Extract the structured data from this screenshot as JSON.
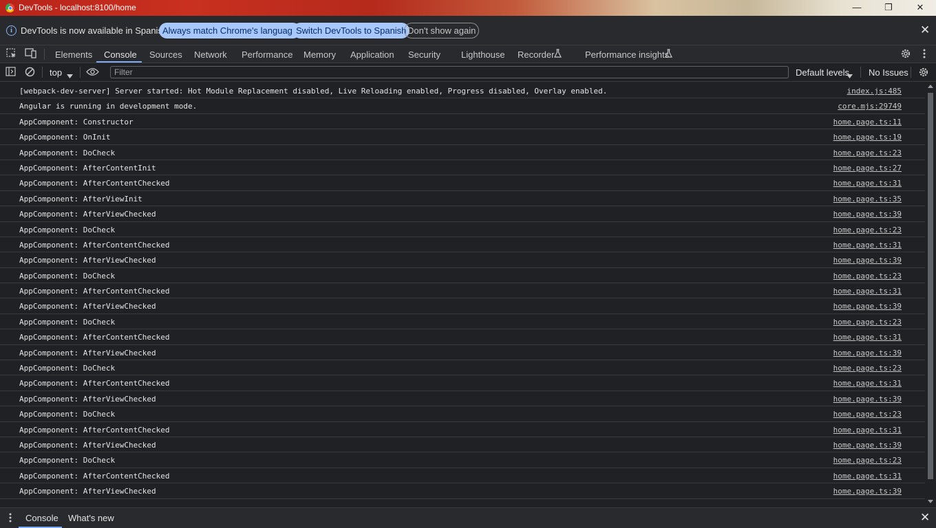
{
  "window": {
    "title": "DevTools - localhost:8100/home",
    "minimize": "—",
    "maximize": "❐",
    "close": "✕"
  },
  "infobar": {
    "message": "DevTools is now available in Spanish!",
    "btn_match": "Always match Chrome's language",
    "btn_switch": "Switch DevTools to Spanish",
    "btn_dismiss": "Don't show again",
    "close": "✕"
  },
  "tabs": [
    "Elements",
    "Console",
    "Sources",
    "Network",
    "Performance",
    "Memory",
    "Application",
    "Security",
    "Lighthouse",
    "Recorder",
    "Performance insights"
  ],
  "active_tab": "Console",
  "toolbar": {
    "context": "top",
    "filter_placeholder": "Filter",
    "levels": "Default levels",
    "issues": "No Issues"
  },
  "logs": [
    {
      "msg": "[webpack-dev-server] Server started: Hot Module Replacement disabled, Live Reloading enabled, Progress disabled, Overlay enabled.",
      "src": "index.js:485"
    },
    {
      "msg": "Angular is running in development mode.",
      "src": "core.mjs:29749"
    },
    {
      "msg": "AppComponent: Constructor",
      "src": "home.page.ts:11"
    },
    {
      "msg": "AppComponent: OnInit",
      "src": "home.page.ts:19"
    },
    {
      "msg": "AppComponent: DoCheck",
      "src": "home.page.ts:23"
    },
    {
      "msg": "AppComponent: AfterContentInit",
      "src": "home.page.ts:27"
    },
    {
      "msg": "AppComponent: AfterContentChecked",
      "src": "home.page.ts:31"
    },
    {
      "msg": "AppComponent: AfterViewInit",
      "src": "home.page.ts:35"
    },
    {
      "msg": "AppComponent: AfterViewChecked",
      "src": "home.page.ts:39"
    },
    {
      "msg": "AppComponent: DoCheck",
      "src": "home.page.ts:23"
    },
    {
      "msg": "AppComponent: AfterContentChecked",
      "src": "home.page.ts:31"
    },
    {
      "msg": "AppComponent: AfterViewChecked",
      "src": "home.page.ts:39"
    },
    {
      "msg": "AppComponent: DoCheck",
      "src": "home.page.ts:23"
    },
    {
      "msg": "AppComponent: AfterContentChecked",
      "src": "home.page.ts:31"
    },
    {
      "msg": "AppComponent: AfterViewChecked",
      "src": "home.page.ts:39"
    },
    {
      "msg": "AppComponent: DoCheck",
      "src": "home.page.ts:23"
    },
    {
      "msg": "AppComponent: AfterContentChecked",
      "src": "home.page.ts:31"
    },
    {
      "msg": "AppComponent: AfterViewChecked",
      "src": "home.page.ts:39"
    },
    {
      "msg": "AppComponent: DoCheck",
      "src": "home.page.ts:23"
    },
    {
      "msg": "AppComponent: AfterContentChecked",
      "src": "home.page.ts:31"
    },
    {
      "msg": "AppComponent: AfterViewChecked",
      "src": "home.page.ts:39"
    },
    {
      "msg": "AppComponent: DoCheck",
      "src": "home.page.ts:23"
    },
    {
      "msg": "AppComponent: AfterContentChecked",
      "src": "home.page.ts:31"
    },
    {
      "msg": "AppComponent: AfterViewChecked",
      "src": "home.page.ts:39"
    },
    {
      "msg": "AppComponent: DoCheck",
      "src": "home.page.ts:23"
    },
    {
      "msg": "AppComponent: AfterContentChecked",
      "src": "home.page.ts:31"
    },
    {
      "msg": "AppComponent: AfterViewChecked",
      "src": "home.page.ts:39"
    }
  ],
  "drawer": {
    "tab_console": "Console",
    "tab_whatsnew": "What's new",
    "close": "✕"
  },
  "icons": [
    "chrome-icon",
    "info-icon",
    "inspect-element-icon",
    "device-toggle-icon",
    "flask-icon",
    "gear-icon",
    "kebab-menu-icon",
    "sidebar-toggle-icon",
    "clear-console-icon",
    "eye-icon",
    "dropdown-arrow-icon"
  ],
  "colors": {
    "accent": "#7cacf8",
    "primary_pill": "#a8c7fa",
    "background": "#202124",
    "panel": "#292a2d"
  }
}
